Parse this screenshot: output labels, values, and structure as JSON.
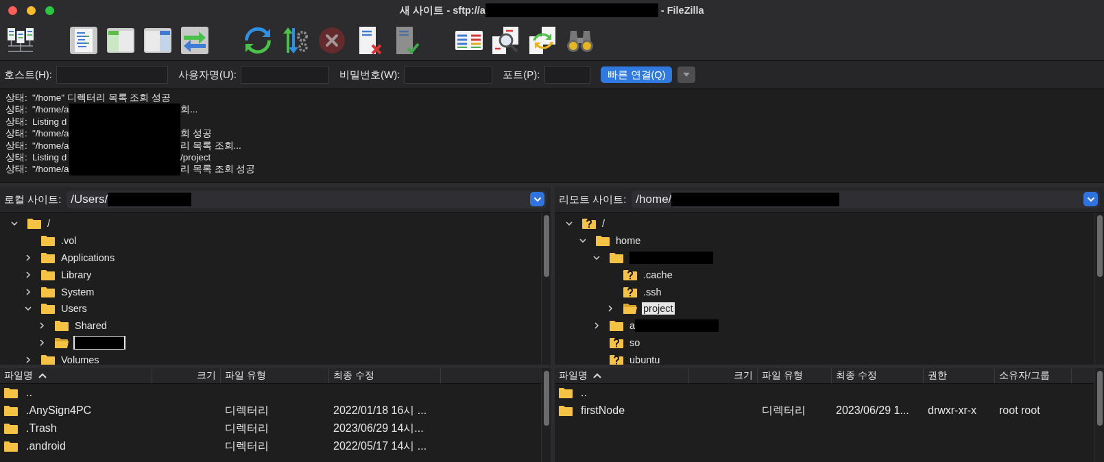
{
  "window": {
    "title_left": "새 사이트 - sftp://a",
    "title_redacted": true,
    "title_right": "- FileZilla"
  },
  "toolbar": [
    {
      "kind": "site-manager",
      "disabled": false
    },
    {
      "kind": "log",
      "disabled": false
    },
    {
      "kind": "local-tree",
      "disabled": false
    },
    {
      "kind": "remote-tree",
      "disabled": false
    },
    {
      "kind": "transfer",
      "disabled": false
    },
    {
      "kind": "refresh",
      "disabled": false
    },
    {
      "kind": "queue",
      "disabled": false
    },
    {
      "kind": "cancel",
      "disabled": true
    },
    {
      "kind": "disconnect",
      "disabled": false
    },
    {
      "kind": "reconnect",
      "disabled": false
    },
    {
      "kind": "compare",
      "disabled": false
    },
    {
      "kind": "filter",
      "disabled": false
    },
    {
      "kind": "sync",
      "disabled": false
    },
    {
      "kind": "find",
      "disabled": false
    }
  ],
  "quickconnect": {
    "fields": [
      {
        "label": "호스트(H):"
      },
      {
        "label": "사용자명(U):"
      },
      {
        "label": "비밀번호(W):"
      },
      {
        "label": "포트(P):"
      }
    ],
    "button": "빠른 연결(Q)",
    "history_disabled": true
  },
  "log": [
    {
      "prefix": "상태:",
      "text": "\"/home\" 디렉터리 목록 조회 성공",
      "redacted": false
    },
    {
      "prefix": "상태:",
      "text": "\"/home/a",
      "redacted": true,
      "after": "회..."
    },
    {
      "prefix": "상태:",
      "text": "Listing d",
      "redacted": true
    },
    {
      "prefix": "상태:",
      "text": "\"/home/a",
      "redacted": true,
      "after": "회 성공"
    },
    {
      "prefix": "상태:",
      "text": "\"/home/a",
      "redacted": true,
      "after": "리 목록 조회..."
    },
    {
      "prefix": "상태:",
      "text": "Listing d",
      "redacted": true,
      "after": "/project"
    },
    {
      "prefix": "상태:",
      "text": "\"/home/a",
      "redacted": true,
      "after": "리 목록 조회 성공"
    }
  ],
  "local": {
    "label": "로컬 사이트:",
    "path": "/Users/",
    "path_redacted": true,
    "tree": [
      {
        "name": "/",
        "kind": "folder",
        "selected": false,
        "expanded": true,
        "children": [
          {
            "name": ".vol",
            "kind": "folder",
            "selected": false
          },
          {
            "name": "Applications",
            "kind": "folder",
            "selected": false,
            "expanded": false
          },
          {
            "name": "Library",
            "kind": "folder",
            "selected": false,
            "expanded": false
          },
          {
            "name": "System",
            "kind": "folder",
            "selected": false,
            "expanded": false
          },
          {
            "name": "Users",
            "kind": "folder",
            "selected": false,
            "expanded": true,
            "children": [
              {
                "name": "Shared",
                "kind": "folder",
                "selected": false,
                "expanded": false
              },
              {
                "redacted": true,
                "kind": "open",
                "selected": true,
                "expanded": false
              }
            ]
          },
          {
            "name": "Volumes",
            "kind": "folder",
            "selected": false,
            "expanded": false
          }
        ]
      }
    ],
    "columns": [
      {
        "label": "파일명",
        "sorted": true
      },
      {
        "label": "크기",
        "sorted": false
      },
      {
        "label": "파일 유형",
        "sorted": false
      },
      {
        "label": "최종 수정",
        "sorted": false
      }
    ],
    "rows": [
      {
        "name": ".."
      },
      {
        "name": ".AnySign4PC",
        "type": "디렉터리",
        "modified": "2022/01/18 16시 ..."
      },
      {
        "name": ".Trash",
        "type": "디렉터리",
        "modified": "2023/06/29 14시..."
      },
      {
        "name": ".android",
        "type": "디렉터리",
        "modified": "2022/05/17 14시 ..."
      }
    ]
  },
  "remote": {
    "label": "리모트 사이트:",
    "path": "/home/",
    "path_redacted": true,
    "tree": [
      {
        "name": "/",
        "kind": "unknown",
        "selected": false,
        "expanded": true,
        "children": [
          {
            "name": "home",
            "kind": "folder",
            "selected": false,
            "expanded": true,
            "children": [
              {
                "redacted": true,
                "kind": "folder",
                "selected": false,
                "expanded": true,
                "children": [
                  {
                    "name": ".cache",
                    "kind": "unknown",
                    "selected": false
                  },
                  {
                    "name": ".ssh",
                    "kind": "unknown",
                    "selected": false
                  },
                  {
                    "name": "project",
                    "kind": "open",
                    "selected": true,
                    "expanded": false
                  }
                ]
              },
              {
                "name": "a",
                "redacted": true,
                "kind": "folder",
                "selected": false,
                "expanded": false
              },
              {
                "name": "so",
                "kind": "unknown",
                "selected": false
              },
              {
                "name": "ubuntu",
                "kind": "unknown",
                "selected": false
              }
            ]
          }
        ]
      }
    ],
    "columns": [
      {
        "label": "파일명",
        "sorted": true
      },
      {
        "label": "크기",
        "sorted": false
      },
      {
        "label": "파일 유형",
        "sorted": false
      },
      {
        "label": "최종 수정",
        "sorted": false
      },
      {
        "label": "권한",
        "sorted": false
      },
      {
        "label": "소유자/그룹",
        "sorted": false
      }
    ],
    "rows": [
      {
        "name": ".."
      },
      {
        "name": "firstNode",
        "type": "디렉터리",
        "modified": "2023/06/29 1...",
        "permissions": "drwxr-xr-x",
        "owner": "root root"
      }
    ]
  }
}
